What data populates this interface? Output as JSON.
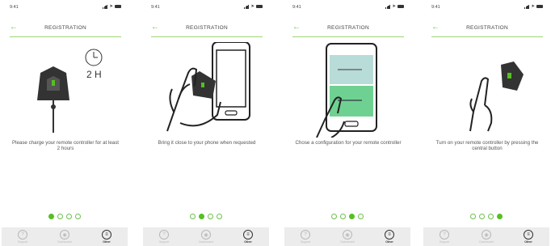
{
  "status": {
    "time": "9:41"
  },
  "header": {
    "back_glyph": "←",
    "title": "REGISTRATION"
  },
  "clock_label": "2 H",
  "steps": [
    {
      "caption": "Please charge your remote controller for at least 2 hours"
    },
    {
      "caption": "Bring it close to your phone when requested"
    },
    {
      "caption": "Chose a configuration for your remote controller"
    },
    {
      "caption": "Turn on your remote controller by pressing the central button"
    }
  ],
  "pagination": {
    "total": 4
  },
  "tabs": [
    {
      "label": "Support",
      "glyph": "?"
    },
    {
      "label": "Dashboard",
      "glyph": "◉"
    },
    {
      "label": "Other",
      "glyph": "≡"
    }
  ],
  "colors": {
    "accent": "#55c020",
    "divider": "#9ed476",
    "tabbar": "#ececec"
  }
}
